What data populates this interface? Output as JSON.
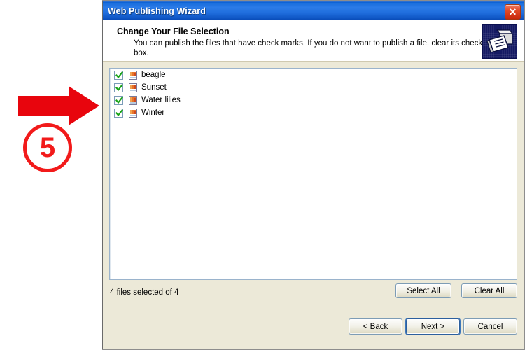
{
  "window": {
    "title": "Web Publishing Wizard",
    "close_icon": "close-icon",
    "close_label": "✕"
  },
  "banner": {
    "title": "Change Your File Selection",
    "description": "You can publish the files that have check marks.  If you do not want to publish a file, clear its check box.",
    "icon": "web-publishing-icon"
  },
  "file_list": {
    "items": [
      {
        "name": "beagle",
        "checked": true,
        "icon": "image-file-icon"
      },
      {
        "name": "Sunset",
        "checked": true,
        "icon": "image-file-icon"
      },
      {
        "name": "Water lilies",
        "checked": true,
        "icon": "image-file-icon"
      },
      {
        "name": "Winter",
        "checked": true,
        "icon": "image-file-icon"
      }
    ]
  },
  "status": {
    "text": "4 files selected of 4",
    "selected_count": 4,
    "total_count": 4
  },
  "selection_buttons": {
    "select_all": "Select All",
    "clear_all": "Clear All"
  },
  "nav_buttons": {
    "back": "< Back",
    "next": "Next >",
    "cancel": "Cancel"
  },
  "annotation": {
    "step_number": "5",
    "arrow": "right-arrow-annotation"
  },
  "colors": {
    "titlebar_blue": "#1b6fdd",
    "dialog_beige": "#ece9d8",
    "annotation_red": "#e8050d",
    "check_green": "#18a317",
    "default_button_border": "#2c5f9e"
  }
}
